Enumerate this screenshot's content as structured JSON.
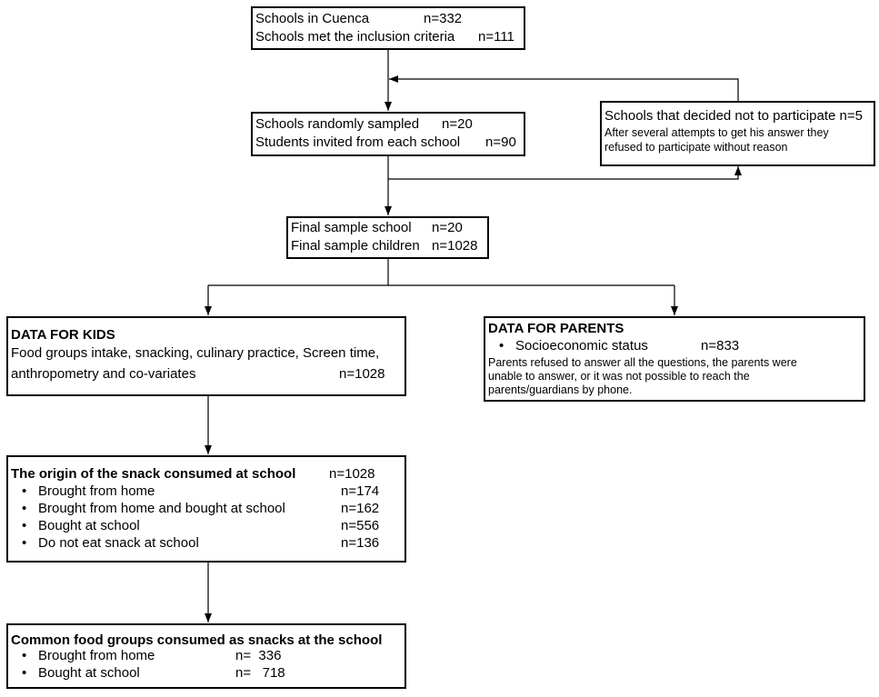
{
  "boxes": {
    "eligible": {
      "l1": "Schools in Cuenca",
      "n1": "n=332",
      "l2": "Schools met the inclusion criteria",
      "n2": "n=111"
    },
    "sampled": {
      "l1": "Schools randomly sampled",
      "n1": "n=20",
      "l2": "Students invited from each school",
      "n2": "n=90"
    },
    "declined": {
      "l1": "Schools that decided not to participate n=5",
      "l2": "After several attempts to get his answer they",
      "l3": "refused to participate without reason"
    },
    "final": {
      "l1": "Final sample school",
      "n1": "n=20",
      "l2": "Final sample children",
      "n2": "n=1028"
    },
    "kids": {
      "title": "DATA FOR KIDS",
      "l1": "Food groups intake, snacking, culinary practice, Screen time,",
      "l2": "anthropometry and co-variates",
      "n2": "n=1028"
    },
    "parents": {
      "title": "DATA FOR PARENTS",
      "item": "Socioeconomic status",
      "n": "n=833",
      "l1": "Parents refused to answer all the questions, the parents were",
      "l2": "unable to answer, or it was not possible to reach the",
      "l3": "parents/guardians by phone."
    },
    "origin": {
      "title": "The origin of the snack consumed at school",
      "n": "n=1028",
      "items": [
        {
          "label": "Brought from home",
          "n": "n=174"
        },
        {
          "label": "Brought from home and bought at school",
          "n": "n=162"
        },
        {
          "label": "Bought at school",
          "n": "n=556"
        },
        {
          "label": "Do not eat snack at school",
          "n": "n=136"
        }
      ]
    },
    "common": {
      "title": "Common food groups consumed as snacks at the school",
      "items": [
        {
          "label": "Brought from home",
          "n": "n=  336"
        },
        {
          "label": "Bought at school",
          "n": "n=   718"
        }
      ]
    }
  }
}
